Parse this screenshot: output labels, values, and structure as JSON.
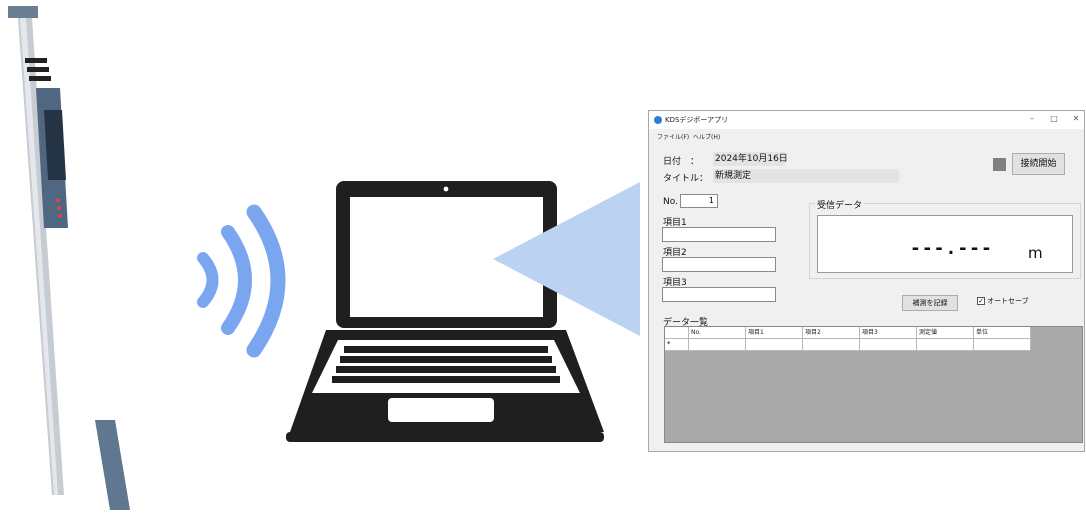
{
  "app": {
    "title": "KDSデジポーアプリ",
    "window_controls": {
      "minimize": "–",
      "maximize": "□",
      "close": "✕"
    }
  },
  "menu": [
    "ファイル(F)",
    "ヘルプ(H)"
  ],
  "header": {
    "date_label": "日付　：",
    "date_value": "2024年10月16日",
    "title_label": "タイトル：",
    "title_value": "新規測定",
    "connect_button": "接続開始",
    "status_color": "#808080"
  },
  "form": {
    "no_label": "No.",
    "no_value": "1",
    "item1_label": "項目1",
    "item2_label": "項目2",
    "item3_label": "項目3"
  },
  "received": {
    "group_label": "受信データ",
    "value": "---.---",
    "unit": "m"
  },
  "record_button": "補測を記録",
  "autosave": {
    "label": "オートセーブ",
    "checked": true
  },
  "table": {
    "title": "データ一覧",
    "columns": [
      "No.",
      "項目1",
      "項目2",
      "項目3",
      "測定値",
      "単位"
    ],
    "new_row_marker": "*"
  },
  "illustration": {
    "device": "laser-measure",
    "wave_color": "#7aa6ef",
    "beam_color": "#bcd2f3"
  }
}
